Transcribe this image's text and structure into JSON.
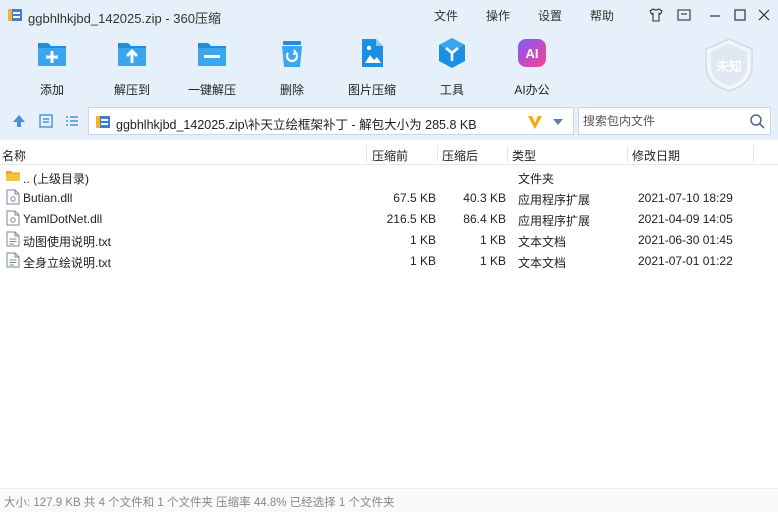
{
  "window": {
    "title": "ggbhlhkjbd_142025.zip - 360压缩",
    "menu": [
      "文件",
      "操作",
      "设置",
      "帮助"
    ]
  },
  "toolbar": {
    "items": [
      {
        "label": "添加",
        "icon": "add-archive-icon"
      },
      {
        "label": "解压到",
        "icon": "extract-to-icon"
      },
      {
        "label": "一键解压",
        "icon": "one-click-extract-icon"
      },
      {
        "label": "删除",
        "icon": "delete-icon"
      },
      {
        "label": "图片压缩",
        "icon": "image-compress-icon"
      },
      {
        "label": "工具",
        "icon": "tools-icon"
      },
      {
        "label": "AI办公",
        "icon": "ai-office-icon"
      }
    ],
    "ai_text": "AI",
    "badge_text": "未知"
  },
  "address": {
    "path": "ggbhlhkjbd_142025.zip\\补天立绘框架补丁 - 解包大小为 285.8 KB",
    "search_placeholder": "搜索包内文件"
  },
  "columns": {
    "name": "名称",
    "size": "压缩前",
    "compressed": "压缩后",
    "type": "类型",
    "modified": "修改日期"
  },
  "files": [
    {
      "name": ".. (上级目录)",
      "size": "",
      "compressed": "",
      "type": "文件夹",
      "modified": "",
      "icon": "folder-icon"
    },
    {
      "name": "Butian.dll",
      "size": "67.5 KB",
      "compressed": "40.3 KB",
      "type": "应用程序扩展",
      "modified": "2021-07-10 18:29",
      "icon": "dll-file-icon"
    },
    {
      "name": "YamlDotNet.dll",
      "size": "216.5 KB",
      "compressed": "86.4 KB",
      "type": "应用程序扩展",
      "modified": "2021-04-09 14:05",
      "icon": "dll-file-icon"
    },
    {
      "name": "动图使用说明.txt",
      "size": "1 KB",
      "compressed": "1 KB",
      "type": "文本文档",
      "modified": "2021-06-30 01:45",
      "icon": "text-file-icon"
    },
    {
      "name": "全身立绘说明.txt",
      "size": "1 KB",
      "compressed": "1 KB",
      "type": "文本文档",
      "modified": "2021-07-01 01:22",
      "icon": "text-file-icon"
    }
  ],
  "status": {
    "text": "大小: 127.9 KB 共 4 个文件和 1 个文件夹 压缩率 44.8% 已经选择 1 个文件夹"
  },
  "colors": {
    "chrome_bg": "#e6f0fa",
    "accent_blue": "#1a8fe3",
    "folder_yellow": "#f5c343",
    "ai_pink": "#e0409a"
  }
}
